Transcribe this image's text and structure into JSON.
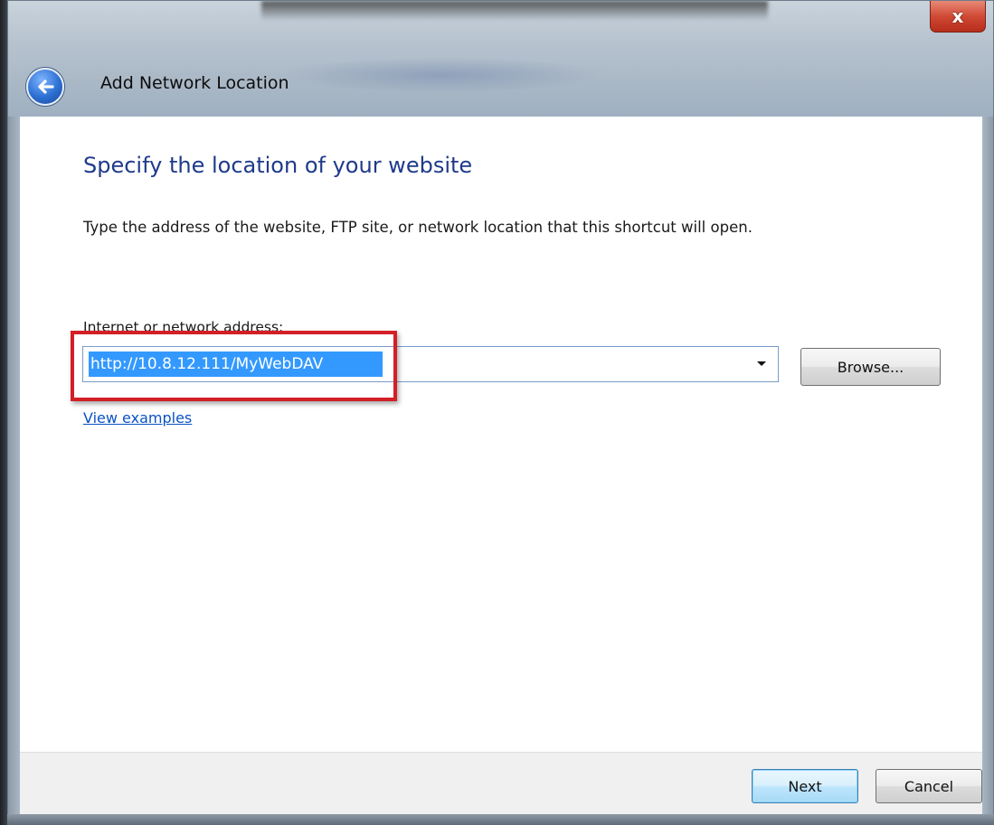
{
  "window": {
    "title": "Add Network Location",
    "close_label": "x"
  },
  "content": {
    "heading": "Specify the location of your website",
    "description": "Type the address of the website, FTP site, or network location that this shortcut will open.",
    "address_label": "Internet or network address:",
    "address_value": "http://10.8.12.111/MyWebDAV",
    "browse_label": "Browse...",
    "view_examples_label": "View examples"
  },
  "footer": {
    "next_label": "Next",
    "cancel_label": "Cancel"
  },
  "colors": {
    "heading": "#1e3a8a",
    "selection": "#3399ff",
    "highlight_box": "#d31f26",
    "link": "#0b52c2"
  },
  "icons": {
    "back": "back-arrow-icon",
    "dropdown": "chevron-down-icon",
    "close": "close-icon"
  }
}
